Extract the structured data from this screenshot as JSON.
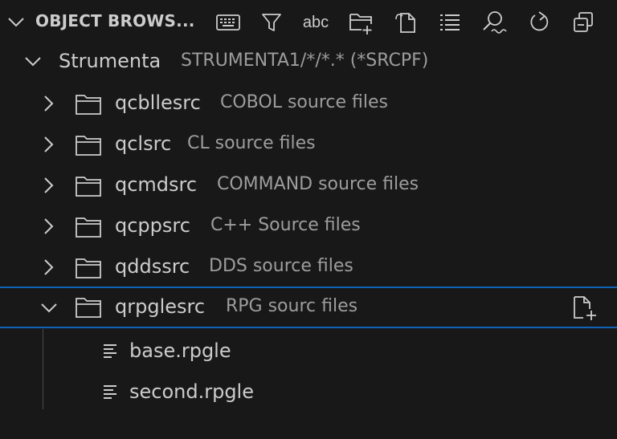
{
  "header": {
    "title": "OBJECT BROWS...",
    "actions": [
      {
        "name": "keyboard-icon"
      },
      {
        "name": "filter-icon"
      },
      {
        "name": "abc",
        "label": "abc"
      },
      {
        "name": "new-folder-icon"
      },
      {
        "name": "new-file-icon"
      },
      {
        "name": "list-icon"
      },
      {
        "name": "search-icon"
      },
      {
        "name": "refresh-icon"
      },
      {
        "name": "collapse-all-icon"
      }
    ]
  },
  "tree": {
    "root": {
      "name": "Strumenta",
      "desc": "STRUMENTA1/*/*.* (*SRCPF)"
    },
    "folders": [
      {
        "name": "qcbllesrc",
        "desc": "COBOL source files"
      },
      {
        "name": "qclsrc",
        "desc": "CL source files"
      },
      {
        "name": "qcmdsrc",
        "desc": "COMMAND source files"
      },
      {
        "name": "qcppsrc",
        "desc": "C++ Source files"
      },
      {
        "name": "qddssrc",
        "desc": "DDS source files"
      },
      {
        "name": "qrpglesrc",
        "desc": "RPG sourc files"
      }
    ],
    "files": [
      {
        "name": "base.rpgle"
      },
      {
        "name": "second.rpgle"
      }
    ]
  }
}
